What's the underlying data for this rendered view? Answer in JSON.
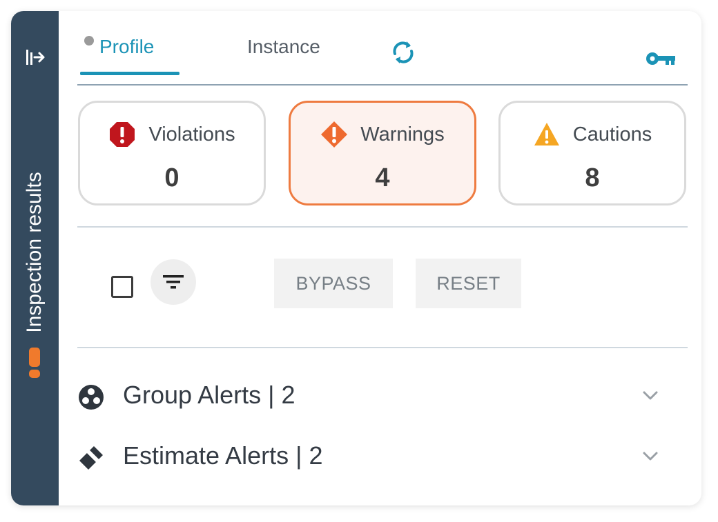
{
  "rail": {
    "title": "Inspection results",
    "collapse_icon": "collapse-arrow-icon",
    "alert_icon": "exclamation-icon",
    "alert_color": "#f07a2c"
  },
  "tabs": [
    {
      "label": "Profile",
      "active": true
    },
    {
      "label": "Instance",
      "active": false
    }
  ],
  "toolbar": {
    "sync_icon": "sync-icon",
    "key_icon": "key-icon"
  },
  "cards": [
    {
      "label": "Violations",
      "count": "0",
      "icon": "violation-octagon-icon",
      "color": "#c0161d"
    },
    {
      "label": "Warnings",
      "count": "4",
      "icon": "warning-diamond-icon",
      "color": "#ee6a2f",
      "selected": true
    },
    {
      "label": "Cautions",
      "count": "8",
      "icon": "caution-triangle-icon",
      "color": "#f5a623"
    }
  ],
  "actions": {
    "bypass": "BYPASS",
    "reset": "RESET"
  },
  "sections": [
    {
      "label": "Group Alerts | 2",
      "icon": "group-icon"
    },
    {
      "label": "Estimate Alerts | 2",
      "icon": "estimate-tag-icon"
    }
  ],
  "colors": {
    "accent": "#1b93b6",
    "rail": "#344a5e",
    "warning_border": "#ee7b40"
  }
}
